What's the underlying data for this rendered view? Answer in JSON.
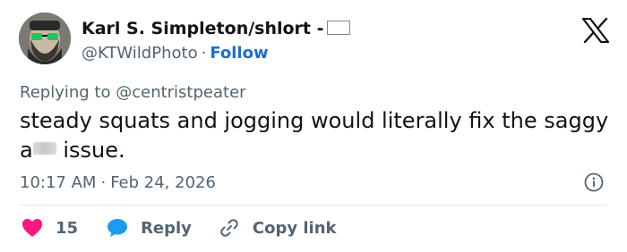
{
  "author": {
    "display_name": "Karl S. Simpleton/shlort -",
    "handle": "@KTWildPhoto",
    "separator": "·",
    "follow_label": "Follow"
  },
  "platform_icon": "x-logo-icon",
  "reply": {
    "prefix": "Replying to",
    "mention": "@centristpeater"
  },
  "tweet": {
    "text_part1": "steady squats and jogging would literally fix the saggy a",
    "text_part2": " issue."
  },
  "meta": {
    "time": "10:17 AM",
    "separator": "·",
    "date": "Feb 24, 2026"
  },
  "actions": {
    "like_count": "15",
    "reply_label": "Reply",
    "copy_link_label": "Copy link"
  },
  "colors": {
    "text": "#0f1419",
    "muted": "#536471",
    "follow": "#1d6fc9",
    "like": "#f91880",
    "reply_bubble": "#1d9bf0"
  }
}
